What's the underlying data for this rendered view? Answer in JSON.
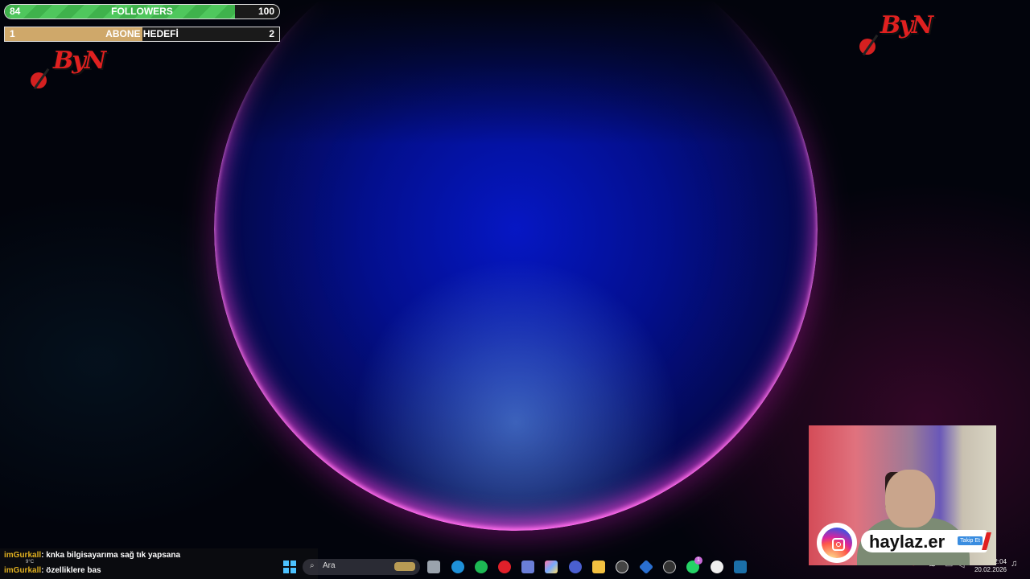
{
  "goals": {
    "followers": {
      "current": "84",
      "label": "FOLLOWERS",
      "target": "100",
      "progress": 0.84
    },
    "subs": {
      "current": "1",
      "label": "ABONE HEDEFİ",
      "target": "2",
      "progress": 0.5
    }
  },
  "logo_text": "ByN",
  "chat": [
    {
      "user": "imGurkall",
      "message": ": knka bilgisayarıma sağ tık yapsana"
    },
    {
      "user": "imGurkall",
      "message": ": özelliklere bas"
    }
  ],
  "taskbar": {
    "search_placeholder": "Ara",
    "weather": "9°C",
    "time": "2:04",
    "date": "20.02.2026",
    "whatsapp_badge": "1",
    "icons": [
      "windows-start-icon",
      "file-explorer-icon",
      "edge-icon",
      "spotify-icon",
      "opera-icon",
      "store-icon",
      "copilot-icon",
      "isp-icon",
      "folder-icon",
      "obs-icon",
      "vpn-icon",
      "chrome-icon",
      "whatsapp-icon",
      "github-icon",
      "steam-icon"
    ]
  },
  "overlay": {
    "instagram_handle": "haylaz.er",
    "follow_label": "Takip Et"
  },
  "colors": {
    "followers_bar": "#4fc75d",
    "subs_bar": "#cfa86a",
    "chat_user": "#e0b020",
    "logo_red": "#e02020"
  }
}
